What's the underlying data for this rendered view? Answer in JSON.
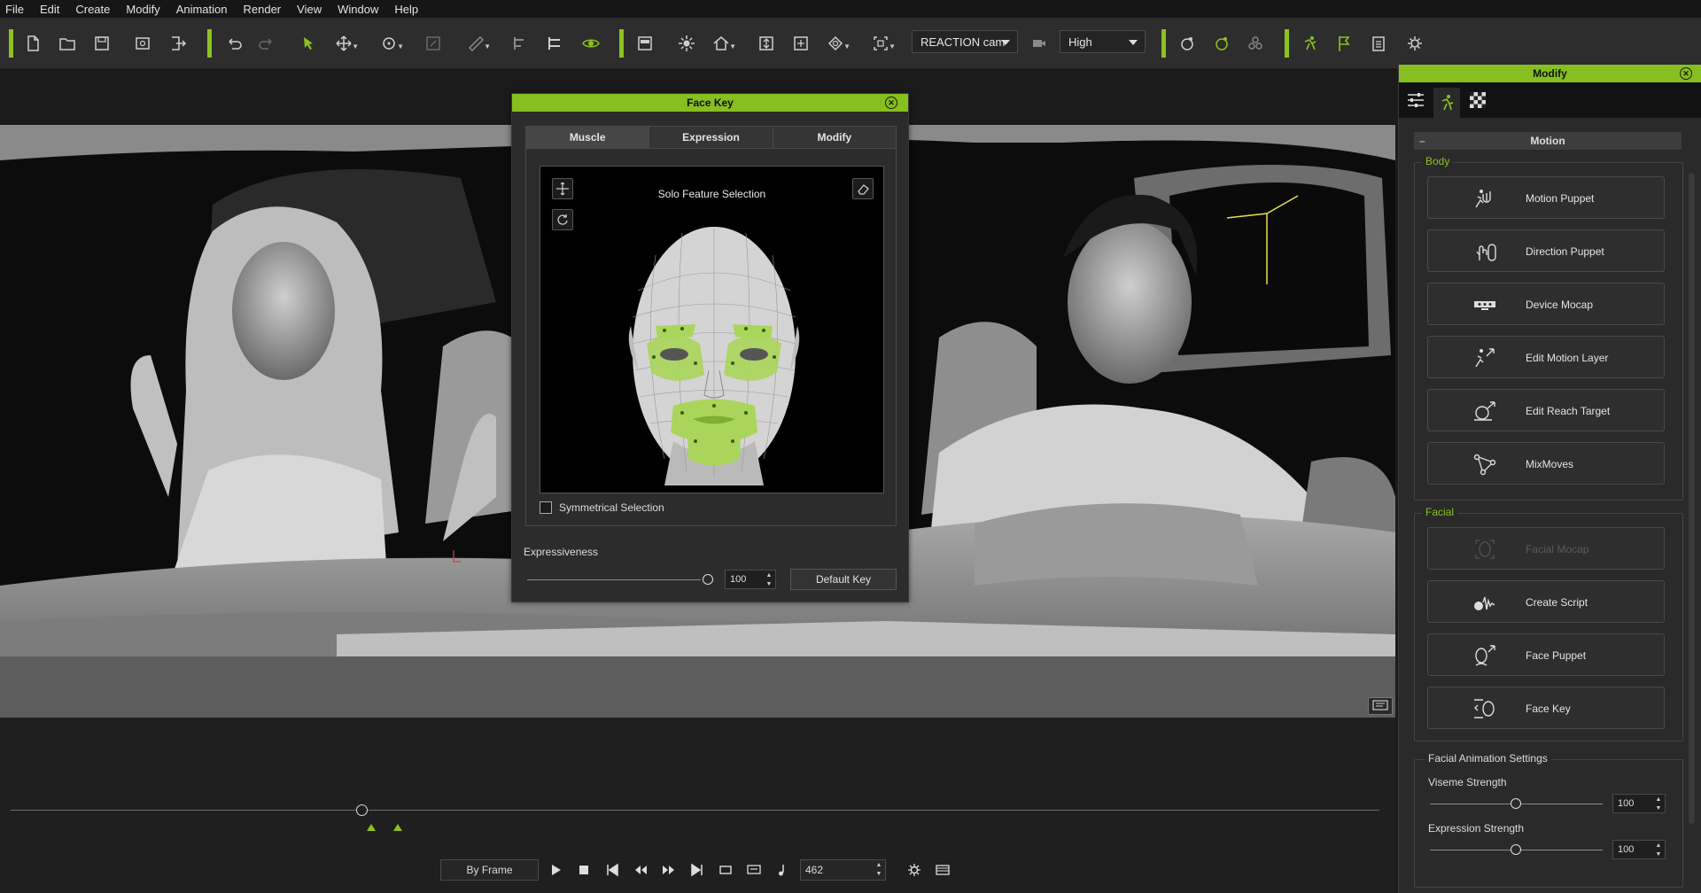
{
  "menu": [
    "File",
    "Edit",
    "Create",
    "Modify",
    "Animation",
    "Render",
    "View",
    "Window",
    "Help"
  ],
  "toolbar": {
    "camera_select": "REACTION cam",
    "quality_select": "High",
    "accent": "#8ac21f"
  },
  "face_key": {
    "title": "Face Key",
    "tabs": [
      "Muscle",
      "Expression",
      "Modify"
    ],
    "active_tab": "Muscle",
    "feature_label": "Solo Feature Selection",
    "symmetrical_label": "Symmetrical Selection",
    "symmetrical_checked": false,
    "expressiveness_label": "Expressiveness",
    "expressiveness_value": "100",
    "default_key_label": "Default Key"
  },
  "modify_panel": {
    "title": "Modify",
    "section": "Motion",
    "body_label": "Body",
    "body_buttons": [
      "Motion Puppet",
      "Direction Puppet",
      "Device Mocap",
      "Edit Motion Layer",
      "Edit Reach Target",
      "MixMoves"
    ],
    "facial_label": "Facial",
    "facial_buttons": [
      "Facial Mocap",
      "Create Script",
      "Face Puppet",
      "Face Key"
    ],
    "facial_disabled": [
      "Facial Mocap"
    ],
    "fas_label": "Facial Animation Settings",
    "viseme_label": "Viseme Strength",
    "viseme_value": "100",
    "expression_label": "Expression Strength",
    "expression_value": "100"
  },
  "timeline": {
    "mode": "By Frame",
    "frame": "462"
  }
}
